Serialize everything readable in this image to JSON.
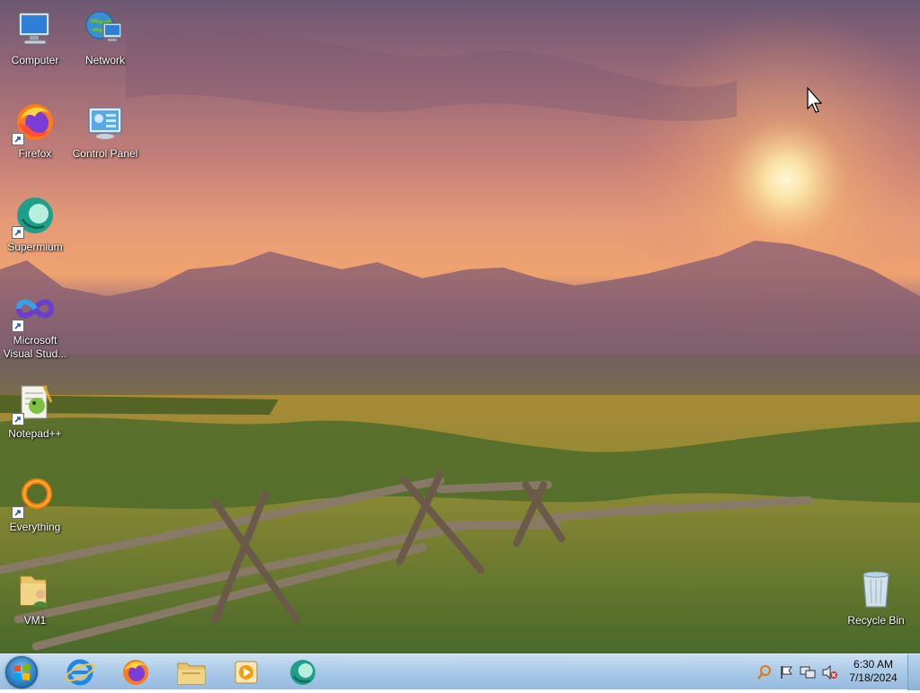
{
  "desktop": {
    "icons": [
      {
        "label": "Computer",
        "icon": "computer-icon"
      },
      {
        "label": "Network",
        "icon": "network-icon"
      },
      {
        "label": "Firefox",
        "icon": "firefox-icon"
      },
      {
        "label": "Control Panel",
        "icon": "control-panel-icon"
      },
      {
        "label": "Supermium",
        "icon": "supermium-icon"
      },
      {
        "label": "Microsoft Visual Stud...",
        "icon": "visual-studio-icon"
      },
      {
        "label": "Notepad++",
        "icon": "notepadpp-icon"
      },
      {
        "label": "Everything",
        "icon": "everything-icon"
      },
      {
        "label": "VM1",
        "icon": "folder-user-icon"
      },
      {
        "label": "Recycle Bin",
        "icon": "recycle-bin-icon"
      }
    ]
  },
  "taskbar": {
    "pinned": [
      {
        "name": "Internet Explorer",
        "icon": "internet-explorer-icon"
      },
      {
        "name": "Firefox",
        "icon": "firefox-icon"
      },
      {
        "name": "Windows Explorer",
        "icon": "file-explorer-icon"
      },
      {
        "name": "Windows Media Player",
        "icon": "media-player-icon"
      },
      {
        "name": "Supermium",
        "icon": "supermium-icon"
      }
    ],
    "tray": {
      "icons": [
        "search-icon",
        "action-center-flag-icon",
        "network-icon",
        "volume-muted-icon"
      ],
      "time": "6:30 AM",
      "date": "7/18/2024"
    }
  },
  "colors": {
    "taskbar": "#a9c9e6",
    "sky_top": "#6d5773",
    "sun": "#fff7d8",
    "grass": "#4f6e2a"
  }
}
